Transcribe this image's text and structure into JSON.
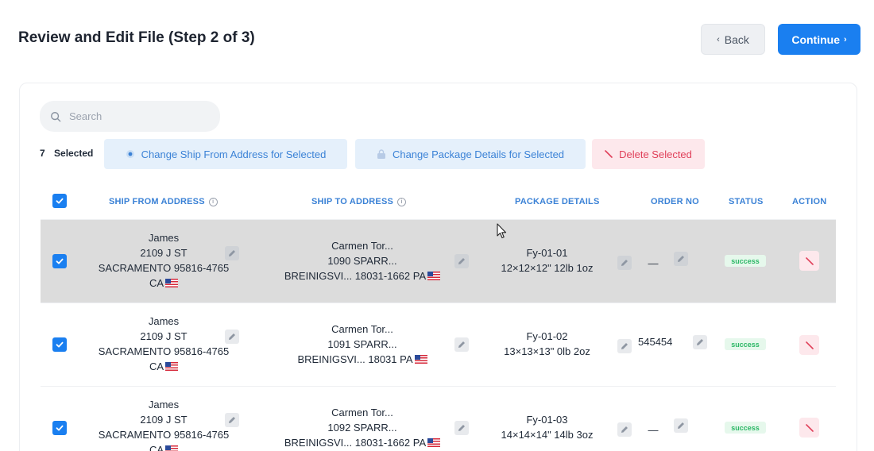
{
  "header": {
    "title": "Review and Edit File (Step 2 of 3)",
    "back_label": "Back",
    "continue_label": "Continue"
  },
  "search": {
    "placeholder": "Search"
  },
  "selection": {
    "count": "7",
    "label": "Selected",
    "actions": {
      "ship_from": "Change Ship From Address for Selected",
      "package": "Change Package Details for Selected",
      "delete": "Delete Selected"
    }
  },
  "table": {
    "columns": {
      "ship_from": "SHIP FROM ADDRESS",
      "ship_to": "SHIP TO ADDRESS",
      "package": "PACKAGE DETAILS",
      "order": "ORDER NO",
      "status": "STATUS",
      "action": "ACTION"
    },
    "rows": [
      {
        "from": {
          "name": "James",
          "street": "2109 J ST",
          "city": "SACRAMENTO 95816-4765",
          "state": "CA"
        },
        "to": {
          "name": "Carmen Tor...",
          "street": "1090 SPARR...",
          "city": "BREINIGSVI... 18031-1662 PA"
        },
        "package": {
          "id": "Fy-01-01",
          "dims": "12×12×12\" 12lb 1oz"
        },
        "order": "—",
        "status": "success"
      },
      {
        "from": {
          "name": "James",
          "street": "2109 J ST",
          "city": "SACRAMENTO 95816-4765",
          "state": "CA"
        },
        "to": {
          "name": "Carmen Tor...",
          "street": "1091 SPARR...",
          "city": "BREINIGSVI... 18031 PA"
        },
        "package": {
          "id": "Fy-01-02",
          "dims": "13×13×13\" 0lb 2oz"
        },
        "order": "545454",
        "status": "success"
      },
      {
        "from": {
          "name": "James",
          "street": "2109 J ST",
          "city": "SACRAMENTO 95816-4765",
          "state": "CA"
        },
        "to": {
          "name": "Carmen Tor...",
          "street": "1092 SPARR...",
          "city": "BREINIGSVI... 18031-1662 PA"
        },
        "package": {
          "id": "Fy-01-03",
          "dims": "14×14×14\" 14lb 3oz"
        },
        "order": "—",
        "status": "success"
      }
    ]
  },
  "colors": {
    "accent": "#1a7ff0",
    "success": "#2bb765",
    "danger": "#e0405a",
    "highlight_row": "#dcdcdc"
  }
}
